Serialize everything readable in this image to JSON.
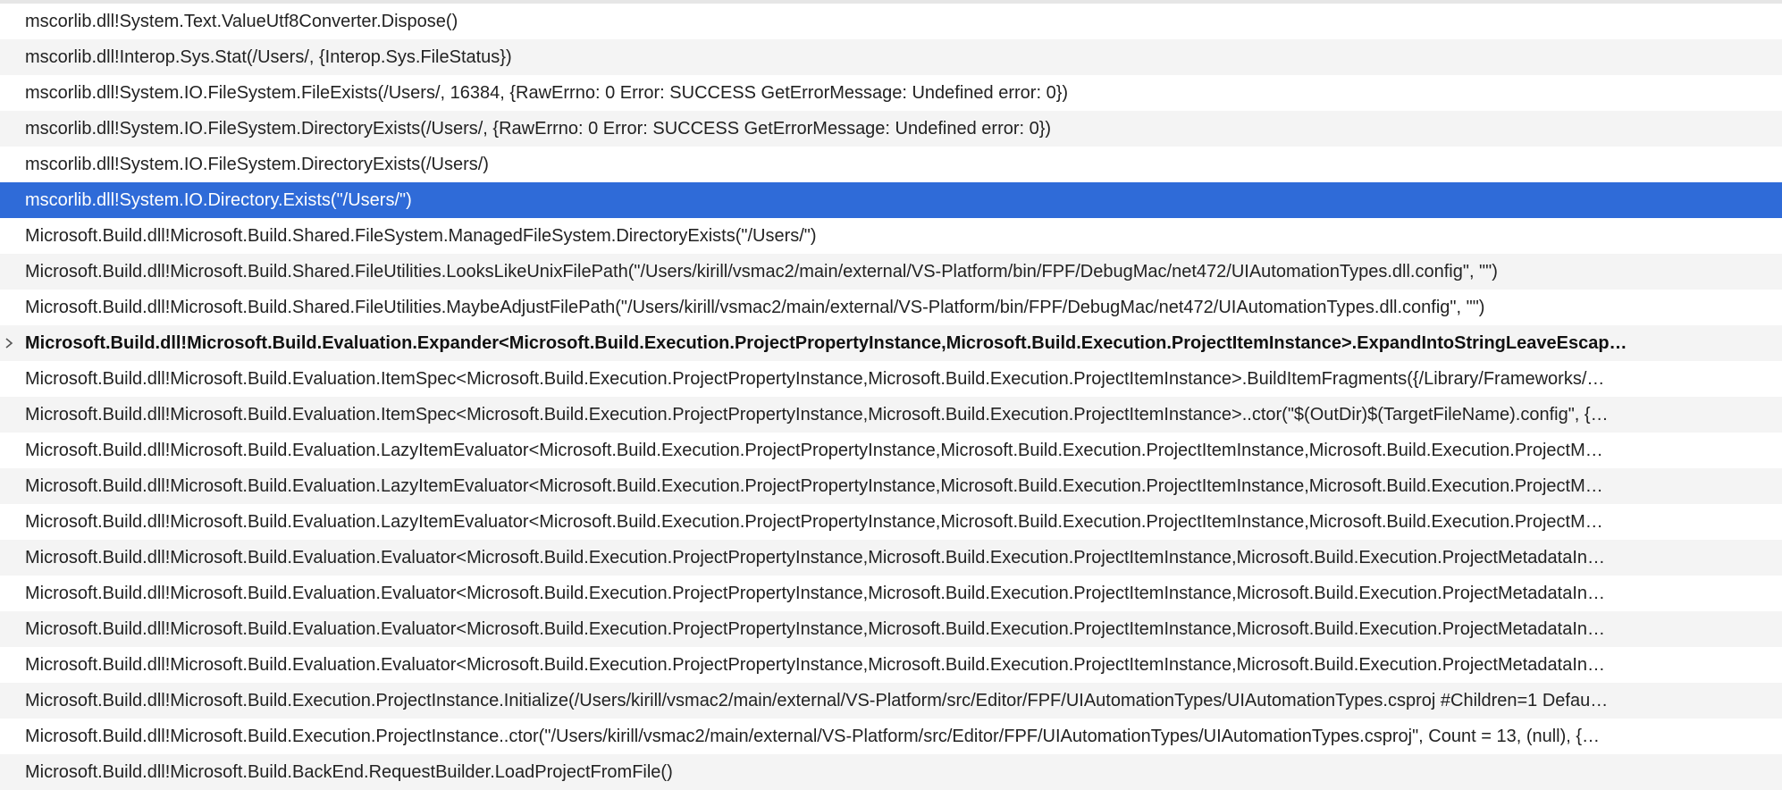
{
  "call_stack": {
    "selected_index": 5,
    "current_index": 9,
    "frames": [
      "mscorlib.dll!System.Text.ValueUtf8Converter.Dispose()",
      "mscorlib.dll!Interop.Sys.Stat(/Users/, {Interop.Sys.FileStatus})",
      "mscorlib.dll!System.IO.FileSystem.FileExists(/Users/, 16384, {RawErrno: 0 Error: SUCCESS GetErrorMessage: Undefined error: 0})",
      "mscorlib.dll!System.IO.FileSystem.DirectoryExists(/Users/, {RawErrno: 0 Error: SUCCESS GetErrorMessage: Undefined error: 0})",
      "mscorlib.dll!System.IO.FileSystem.DirectoryExists(/Users/)",
      "mscorlib.dll!System.IO.Directory.Exists(\"/Users/\")",
      "Microsoft.Build.dll!Microsoft.Build.Shared.FileSystem.ManagedFileSystem.DirectoryExists(\"/Users/\")",
      "Microsoft.Build.dll!Microsoft.Build.Shared.FileUtilities.LooksLikeUnixFilePath(\"/Users/kirill/vsmac2/main/external/VS-Platform/bin/FPF/DebugMac/net472/UIAutomationTypes.dll.config\", \"\")",
      "Microsoft.Build.dll!Microsoft.Build.Shared.FileUtilities.MaybeAdjustFilePath(\"/Users/kirill/vsmac2/main/external/VS-Platform/bin/FPF/DebugMac/net472/UIAutomationTypes.dll.config\", \"\")",
      "Microsoft.Build.dll!Microsoft.Build.Evaluation.Expander<Microsoft.Build.Execution.ProjectPropertyInstance,Microsoft.Build.Execution.ProjectItemInstance>.ExpandIntoStringLeaveEscap…",
      "Microsoft.Build.dll!Microsoft.Build.Evaluation.ItemSpec<Microsoft.Build.Execution.ProjectPropertyInstance,Microsoft.Build.Execution.ProjectItemInstance>.BuildItemFragments({/Library/Frameworks/…",
      "Microsoft.Build.dll!Microsoft.Build.Evaluation.ItemSpec<Microsoft.Build.Execution.ProjectPropertyInstance,Microsoft.Build.Execution.ProjectItemInstance>..ctor(\"$(OutDir)$(TargetFileName).config\", {…",
      "Microsoft.Build.dll!Microsoft.Build.Evaluation.LazyItemEvaluator<Microsoft.Build.Execution.ProjectPropertyInstance,Microsoft.Build.Execution.ProjectItemInstance,Microsoft.Build.Execution.ProjectM…",
      "Microsoft.Build.dll!Microsoft.Build.Evaluation.LazyItemEvaluator<Microsoft.Build.Execution.ProjectPropertyInstance,Microsoft.Build.Execution.ProjectItemInstance,Microsoft.Build.Execution.ProjectM…",
      "Microsoft.Build.dll!Microsoft.Build.Evaluation.LazyItemEvaluator<Microsoft.Build.Execution.ProjectPropertyInstance,Microsoft.Build.Execution.ProjectItemInstance,Microsoft.Build.Execution.ProjectM…",
      "Microsoft.Build.dll!Microsoft.Build.Evaluation.Evaluator<Microsoft.Build.Execution.ProjectPropertyInstance,Microsoft.Build.Execution.ProjectItemInstance,Microsoft.Build.Execution.ProjectMetadataIn…",
      "Microsoft.Build.dll!Microsoft.Build.Evaluation.Evaluator<Microsoft.Build.Execution.ProjectPropertyInstance,Microsoft.Build.Execution.ProjectItemInstance,Microsoft.Build.Execution.ProjectMetadataIn…",
      "Microsoft.Build.dll!Microsoft.Build.Evaluation.Evaluator<Microsoft.Build.Execution.ProjectPropertyInstance,Microsoft.Build.Execution.ProjectItemInstance,Microsoft.Build.Execution.ProjectMetadataIn…",
      "Microsoft.Build.dll!Microsoft.Build.Evaluation.Evaluator<Microsoft.Build.Execution.ProjectPropertyInstance,Microsoft.Build.Execution.ProjectItemInstance,Microsoft.Build.Execution.ProjectMetadataIn…",
      "Microsoft.Build.dll!Microsoft.Build.Execution.ProjectInstance.Initialize(/Users/kirill/vsmac2/main/external/VS-Platform/src/Editor/FPF/UIAutomationTypes/UIAutomationTypes.csproj #Children=1 Defau…",
      "Microsoft.Build.dll!Microsoft.Build.Execution.ProjectInstance..ctor(\"/Users/kirill/vsmac2/main/external/VS-Platform/src/Editor/FPF/UIAutomationTypes/UIAutomationTypes.csproj\", Count = 13, (null), {…",
      "Microsoft.Build.dll!Microsoft.Build.BackEnd.RequestBuilder.LoadProjectFromFile()"
    ]
  },
  "colors": {
    "selection": "#2f6bd8",
    "row_alt": "#f4f4f4",
    "text": "#222222"
  },
  "icons": {
    "current_frame": "chevron-right-icon"
  }
}
